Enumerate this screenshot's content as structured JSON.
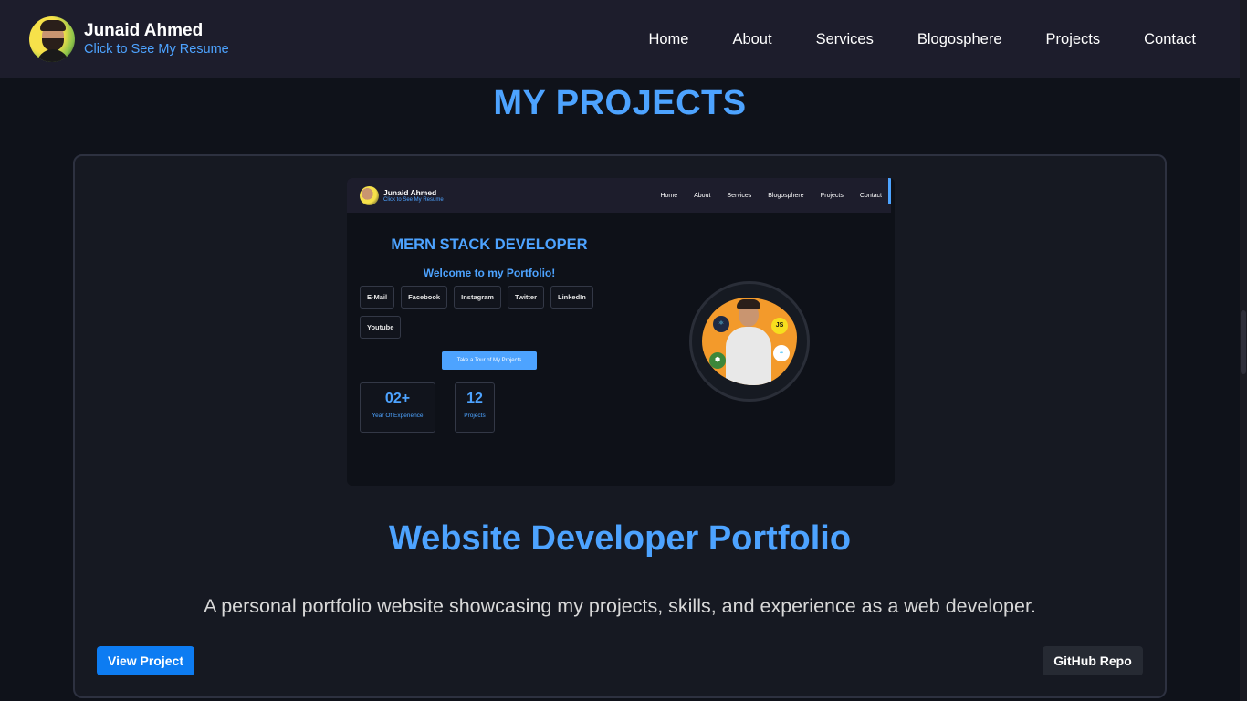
{
  "header": {
    "name": "Junaid Ahmed",
    "resume_link": "Click to See My Resume",
    "avatar_icon": "profile-avatar",
    "nav": [
      "Home",
      "About",
      "Services",
      "Blogosphere",
      "Projects",
      "Contact"
    ]
  },
  "page": {
    "section_title": "MY PROJECTS"
  },
  "project": {
    "title": "Website Developer Portfolio",
    "description": "A personal portfolio website showcasing my projects, skills, and experience as a web developer.",
    "view_label": "View Project",
    "repo_label": "GitHub Repo",
    "preview": {
      "name": "Junaid Ahmed",
      "resume_link": "Click to See My Resume",
      "nav": [
        "Home",
        "About",
        "Services",
        "Blogosphere",
        "Projects",
        "Contact"
      ],
      "headline": "MERN STACK DEVELOPER",
      "welcome": "Welcome to my Portfolio!",
      "socials": [
        "E-Mail",
        "Facebook",
        "Instagram",
        "Twitter",
        "LinkedIn",
        "Youtube"
      ],
      "tour_button": "Take a Tour of My Projects",
      "stats": [
        {
          "value": "02+",
          "label": "Year Of Experience"
        },
        {
          "value": "12",
          "label": "Projects"
        }
      ],
      "badges": [
        "JS"
      ]
    }
  },
  "colors": {
    "accent": "#4da3ff",
    "primary_button": "#0d7cf2",
    "background": "#0f121a",
    "nav_background": "#1d1d2c"
  }
}
